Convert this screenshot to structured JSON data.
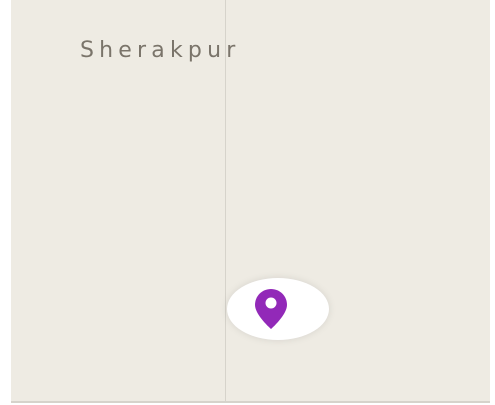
{
  "map": {
    "place_label": "Sherakpur",
    "colors": {
      "land": "#eeebe3",
      "road": "#d6d3cb",
      "label_text": "#7a746a",
      "marker": "#9229b8",
      "marker_halo": "#ffffff",
      "page_background": "#ffffff"
    },
    "marker": {
      "icon": "map-pin-icon"
    }
  }
}
